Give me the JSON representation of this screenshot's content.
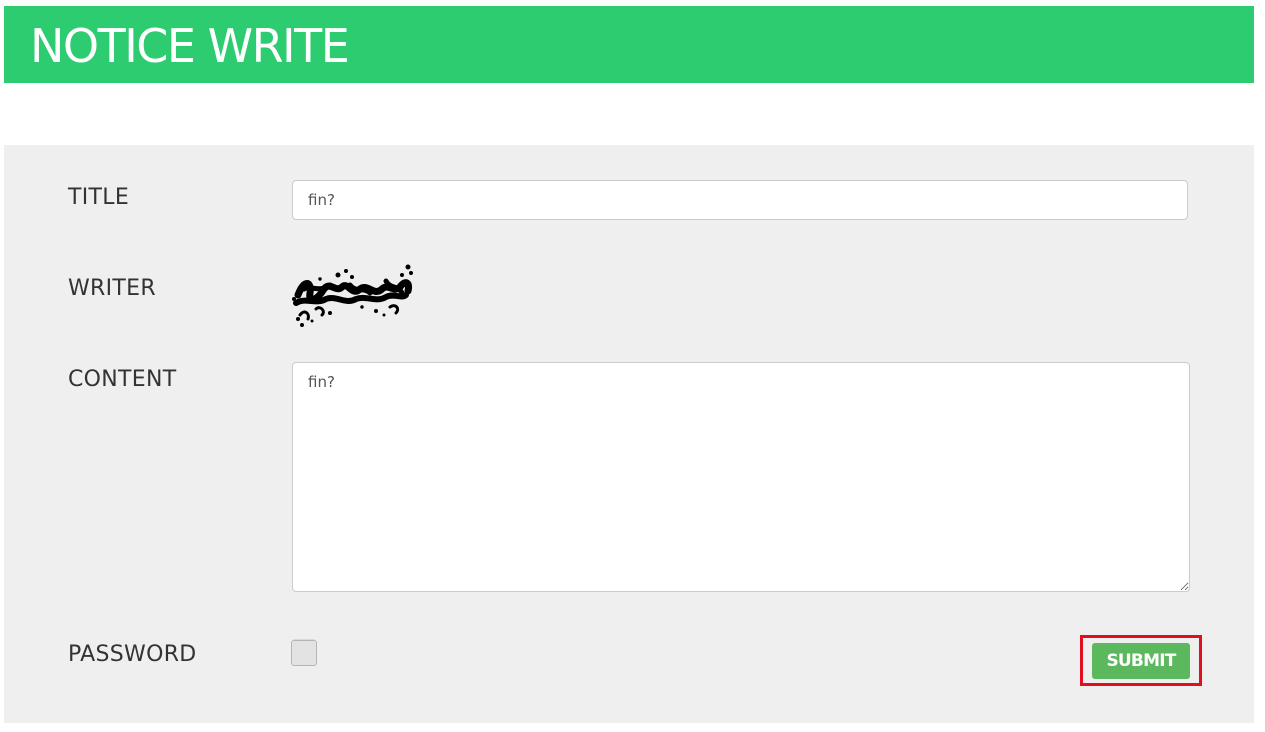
{
  "header": {
    "title": "NOTICE WRITE",
    "color": "#2ecc71"
  },
  "form": {
    "title_label": "TITLE",
    "title_value": "fin?",
    "writer_label": "WRITER",
    "writer_value_image": "redacted-scribble",
    "content_label": "CONTENT",
    "content_value": "fin?",
    "password_label": "PASSWORD",
    "submit_label": "SUBMIT",
    "submit_color": "#5cb85c",
    "highlight_color": "#e0101e"
  }
}
